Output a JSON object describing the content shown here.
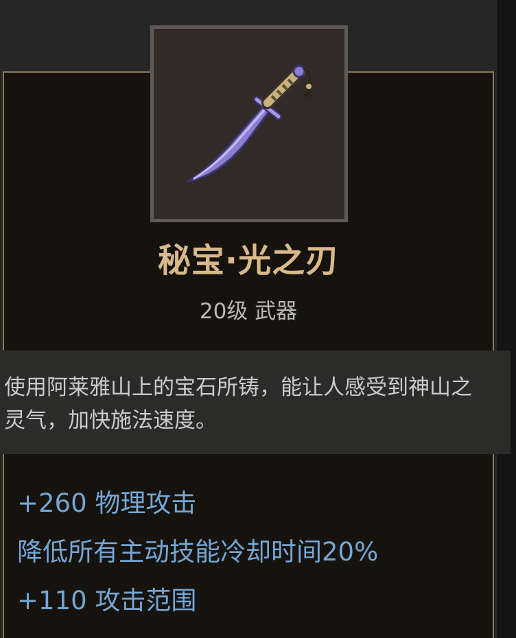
{
  "item": {
    "name": "秘宝·光之刃",
    "subtitle": "20级 武器",
    "icon": "purple-katana-icon",
    "description": "使用阿莱雅山上的宝石所铸，能让人感受到神山之灵气，加快施法速度。",
    "stats": [
      "+260 物理攻击",
      "降低所有主动技能冷却时间20%",
      "+110 攻击范围"
    ]
  },
  "colors": {
    "title": "#d9b98a",
    "stat": "#74a6d4",
    "border": "#8c7a58"
  }
}
